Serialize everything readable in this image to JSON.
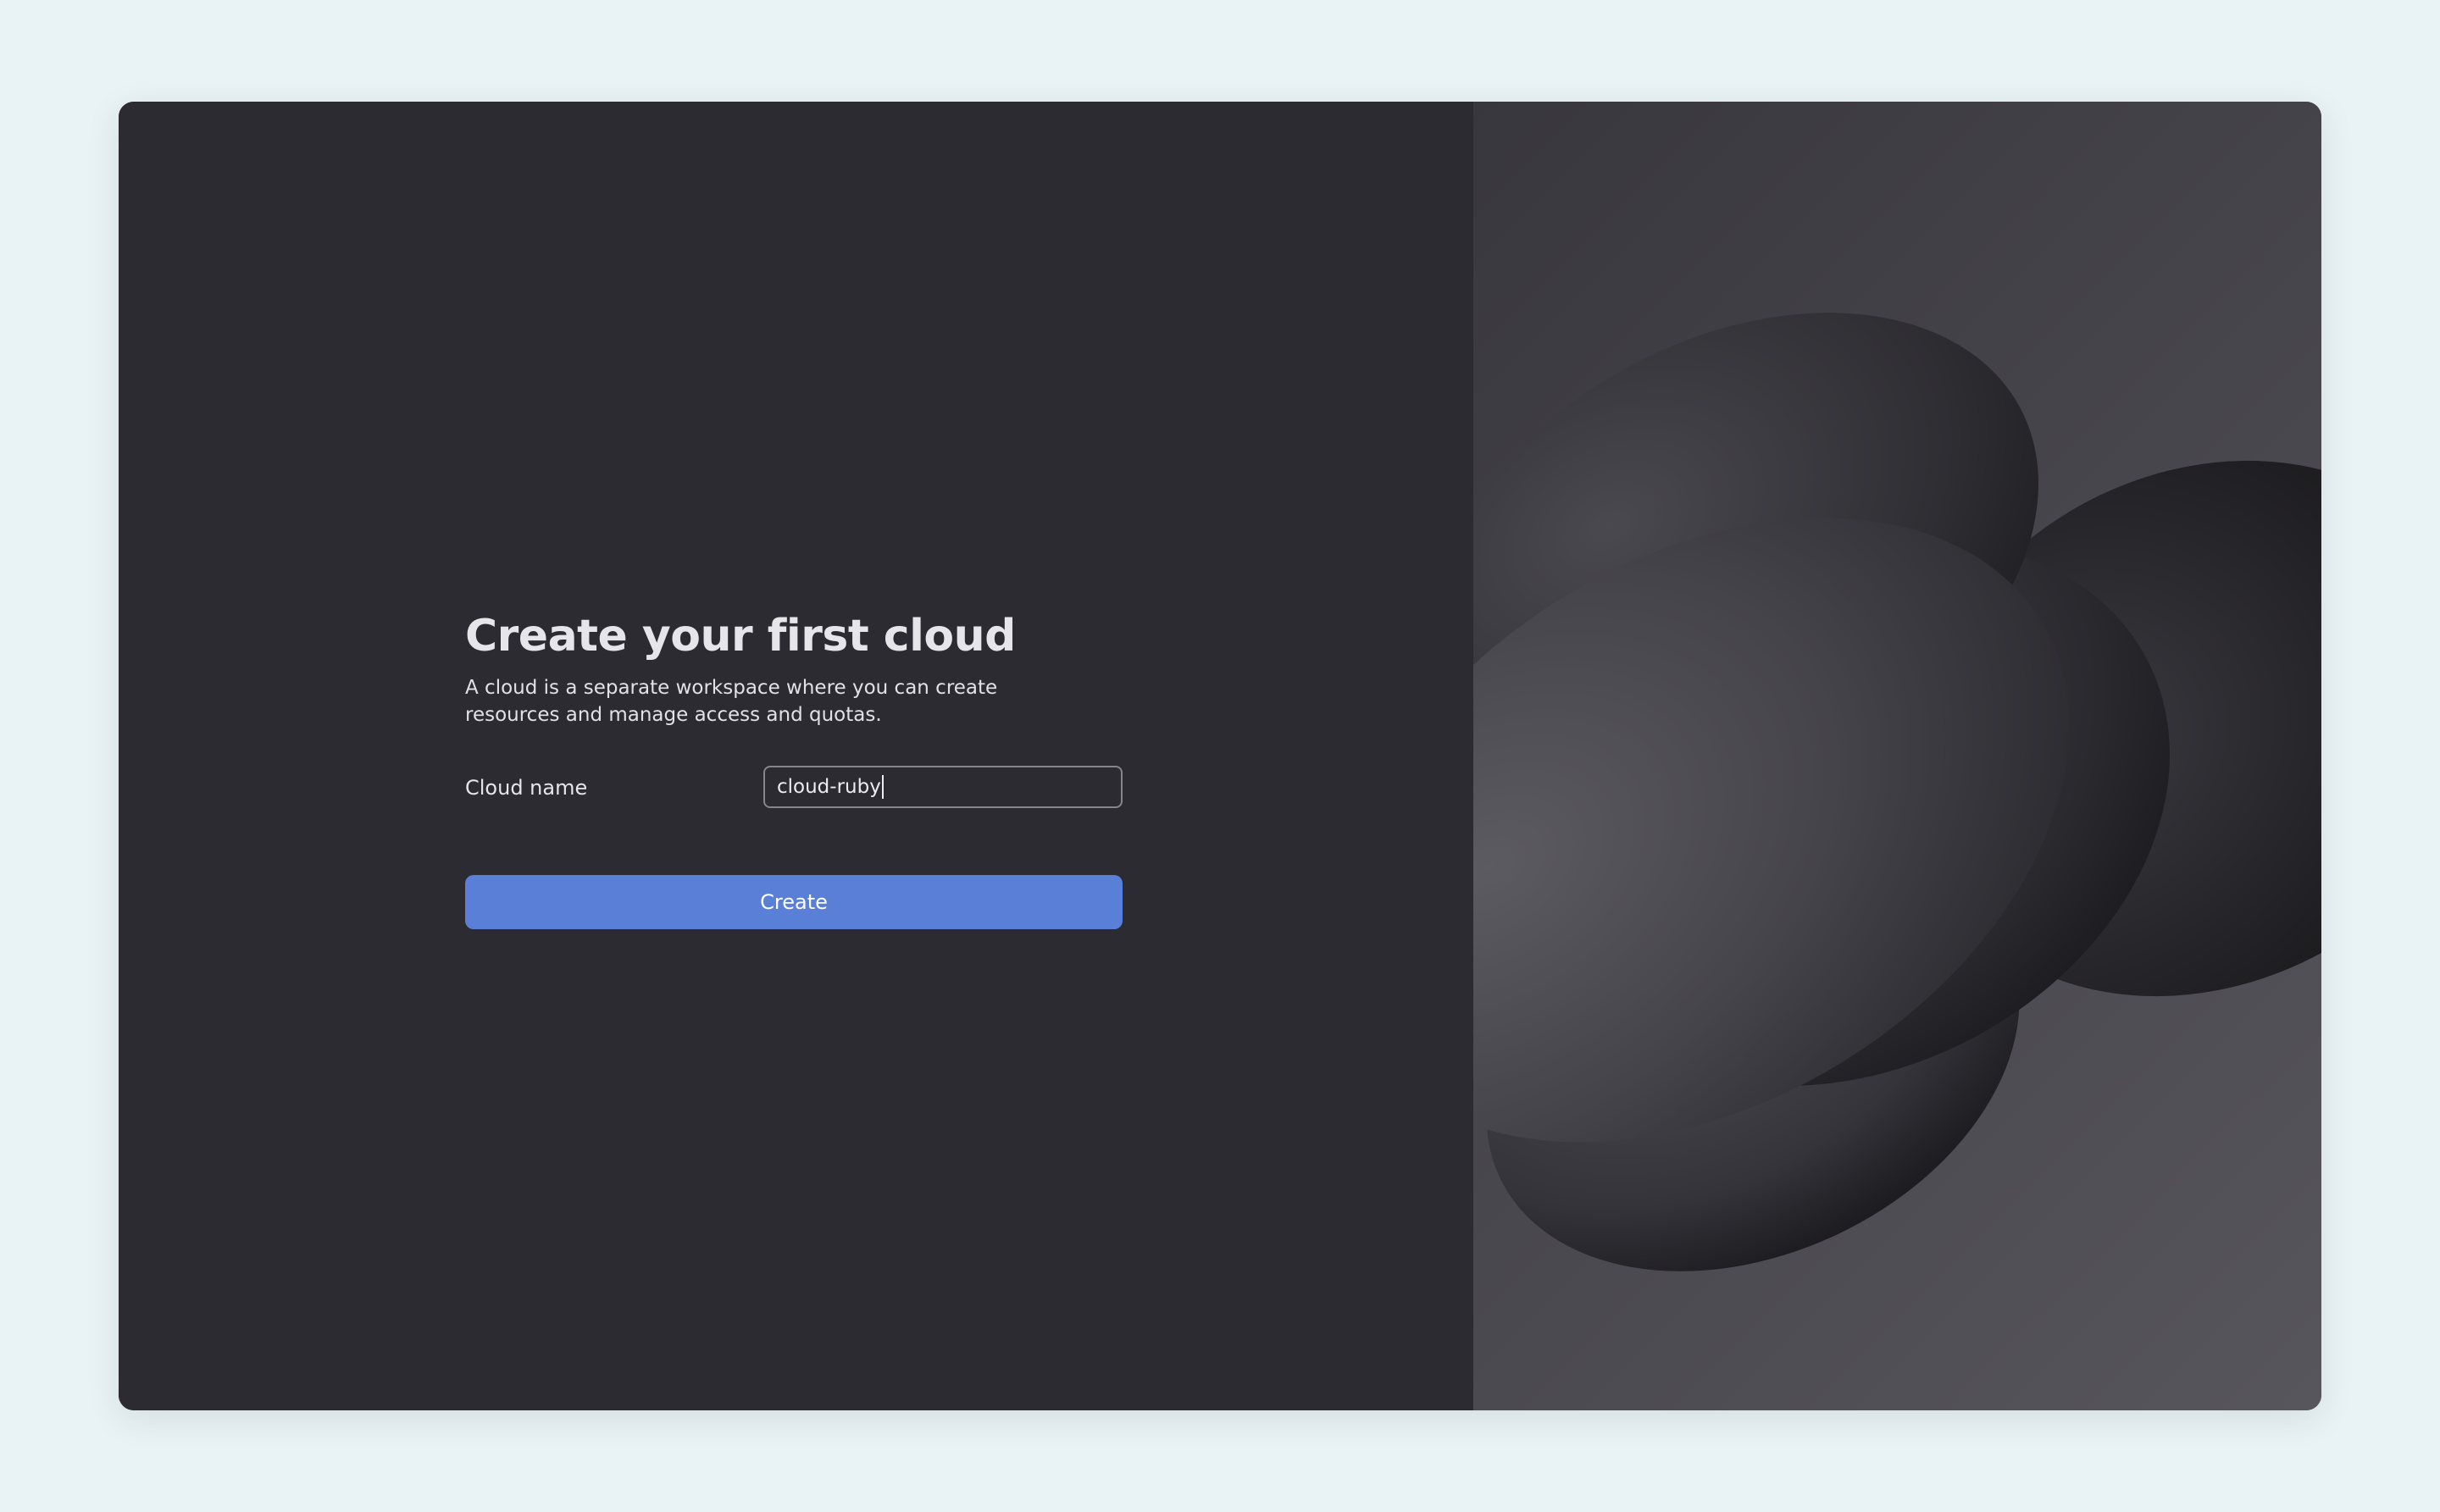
{
  "dialog": {
    "title": "Create your first cloud",
    "description": "A cloud is a separate workspace where you can create resources and manage access and quotas.",
    "cloud_name_label": "Cloud name",
    "cloud_name_value": "cloud-ruby",
    "create_label": "Create"
  },
  "colors": {
    "page_background": "#e9f2f4",
    "panel_background": "#2c2b31",
    "primary_button": "#5a7fd6",
    "input_border": "#86858c"
  },
  "illustration": {
    "name": "abstract-cloud-shapes"
  }
}
